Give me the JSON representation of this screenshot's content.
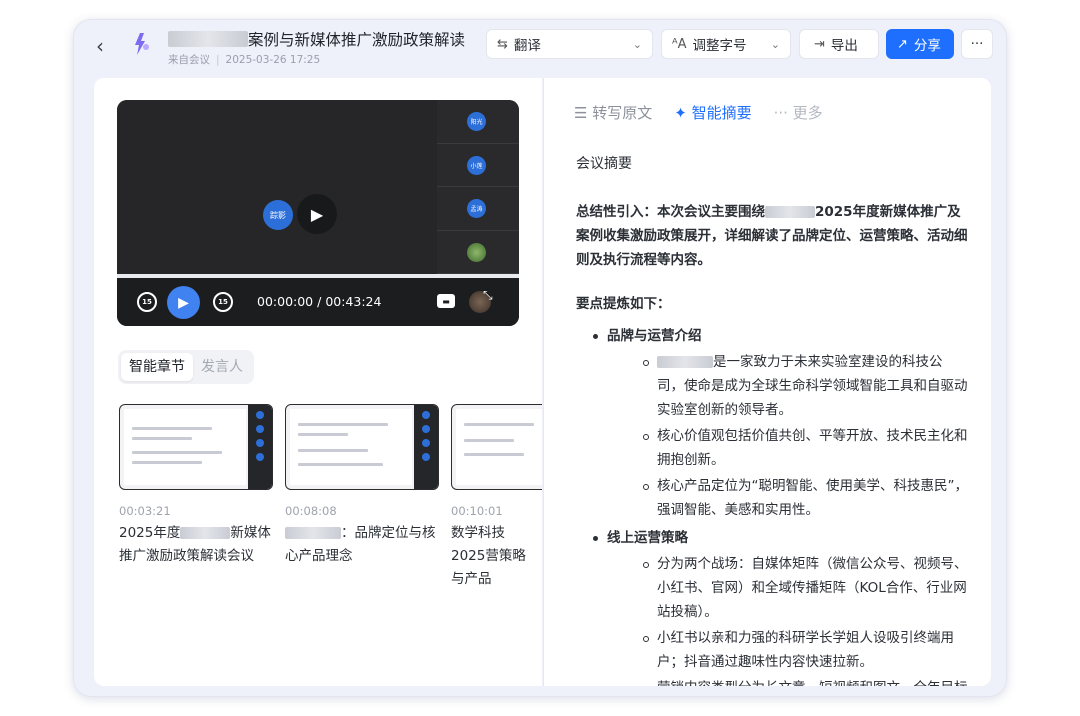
{
  "header": {
    "title": "案例与新媒体推广激励政策解读",
    "source": "来自会议",
    "datetime": "2025-03-26 17:25",
    "translate_label": "翻译",
    "font_size_label": "调整字号",
    "export_label": "导出",
    "share_label": "分享",
    "more_label": "···"
  },
  "video": {
    "current_time": "00:00:00",
    "total_time": "00:43:24",
    "progress": 0,
    "center_avatar": "踪影",
    "thumb_avatars": [
      "阳光",
      "小莲",
      "孟涛"
    ],
    "skip_back": "15",
    "skip_forward": "15"
  },
  "left_tabs": [
    "智能章节",
    "发言人"
  ],
  "chapters": [
    {
      "time": "00:03:21",
      "title": "2025年度",
      "title2": "新媒体推广激励政策解读会议"
    },
    {
      "time": "00:08:08",
      "title": "：品牌定位与核心产品理念"
    },
    {
      "time": "00:10:01",
      "title": "数学科技2025营策略与产品"
    }
  ],
  "right_tabs": [
    "转写原文",
    "智能摘要",
    "更多"
  ],
  "summary": {
    "heading": "会议摘要",
    "intro_a": "总结性引入：本次会议主要围绕",
    "intro_b": "2025年度新媒体推广及案例收集激励政策展开，详细解读了品牌定位、运营策略、活动细则及执行流程等内容。",
    "points_heading": "要点提炼如下：",
    "section1": "品牌与运营介绍",
    "s1_item1": "是一家致力于未来实验室建设的科技公司，使命是成为全球生命科学领域智能工具和自驱动实验室创新的领导者。",
    "s1_item2": "核心价值观包括价值共创、平等开放、技术民主化和拥抱创新。",
    "s1_item3": "核心产品定位为“聪明智能、使用美学、科技惠民”，强调智能、美感和实用性。",
    "section2": "线上运营策略",
    "s2_item1": "分为两个战场：自媒体矩阵（微信公众号、视频号、小红书、官网）和全域传播矩阵（KOL合作、行业网站投稿）。",
    "s2_item2": "小红书以亲和力强的科研学长学姐人设吸引终端用户；抖音通过趣味性内容快速拉新。",
    "s2_item3": "营销内容类型分为长文章、短视频和图文，全年目标为提升品牌知名度和打造明星产品全域口碑。"
  }
}
